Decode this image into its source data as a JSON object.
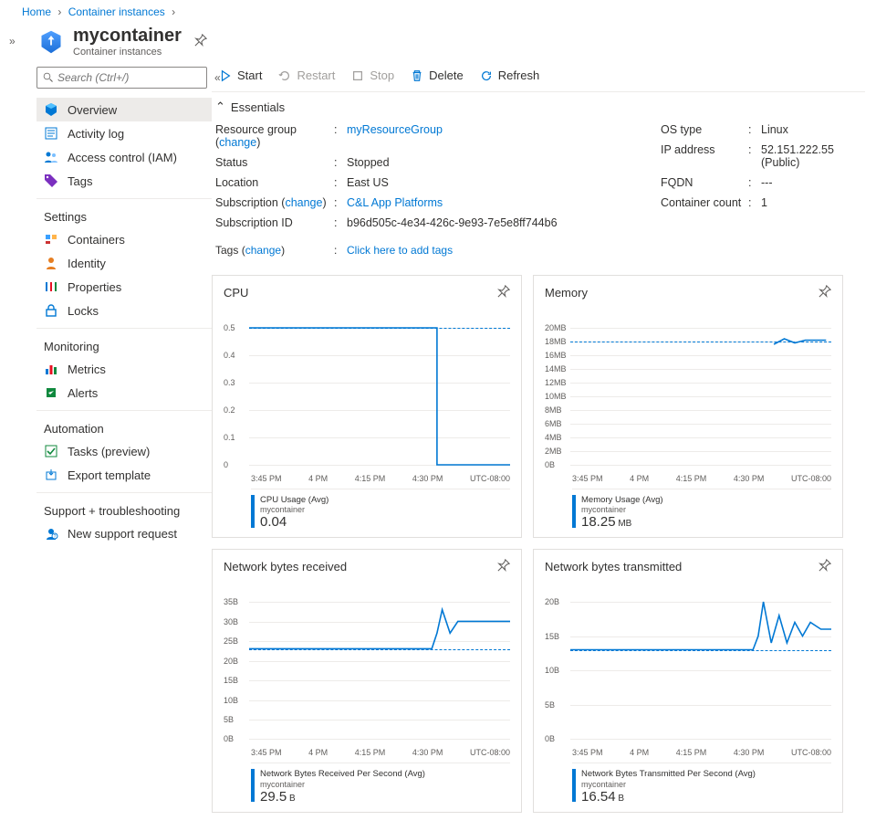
{
  "breadcrumb": {
    "home": "Home",
    "ci": "Container instances"
  },
  "title": "mycontainer",
  "subtitle": "Container instances",
  "search_placeholder": "Search (Ctrl+/)",
  "nav": {
    "overview": "Overview",
    "activity": "Activity log",
    "iam": "Access control (IAM)",
    "tags": "Tags",
    "heading_settings": "Settings",
    "containers": "Containers",
    "identity": "Identity",
    "properties": "Properties",
    "locks": "Locks",
    "heading_monitoring": "Monitoring",
    "metrics": "Metrics",
    "alerts": "Alerts",
    "heading_automation": "Automation",
    "tasks": "Tasks (preview)",
    "export": "Export template",
    "heading_support": "Support + troubleshooting",
    "support": "New support request"
  },
  "toolbar": {
    "start": "Start",
    "restart": "Restart",
    "stop": "Stop",
    "delete": "Delete",
    "refresh": "Refresh"
  },
  "essentials": {
    "header": "Essentials",
    "change": "change",
    "left": {
      "rg_label": "Resource group",
      "rg_value": "myResourceGroup",
      "status_label": "Status",
      "status_value": "Stopped",
      "loc_label": "Location",
      "loc_value": "East US",
      "sub_label": "Subscription",
      "sub_value": "C&L App Platforms",
      "subid_label": "Subscription ID",
      "subid_value": "b96d505c-4e34-426c-9e93-7e5e8ff744b6"
    },
    "right": {
      "os_label": "OS type",
      "os_value": "Linux",
      "ip_label": "IP address",
      "ip_value": "52.151.222.55 (Public)",
      "fqdn_label": "FQDN",
      "fqdn_value": "---",
      "count_label": "Container count",
      "count_value": "1"
    },
    "tags_label": "Tags",
    "tags_value": "Click here to add tags"
  },
  "chart_data": [
    {
      "title": "CPU",
      "type": "line",
      "y_ticks": [
        "0.5",
        "0.4",
        "0.3",
        "0.2",
        "0.1",
        "0"
      ],
      "x_ticks": [
        "3:45 PM",
        "4 PM",
        "4:15 PM",
        "4:30 PM",
        "UTC-08:00"
      ],
      "avg_dashed": 0.5,
      "series": [
        {
          "name": "CPU Usage (Avg)",
          "points": [
            [
              0,
              0.5
            ],
            [
              0.72,
              0.5
            ],
            [
              0.72,
              0
            ],
            [
              1,
              0
            ]
          ]
        }
      ],
      "metric_name": "CPU Usage (Avg)",
      "metric_sub": "mycontainer",
      "metric_value": "0.04",
      "metric_unit": ""
    },
    {
      "title": "Memory",
      "type": "line",
      "y_ticks": [
        "20MB",
        "18MB",
        "16MB",
        "14MB",
        "12MB",
        "10MB",
        "8MB",
        "6MB",
        "4MB",
        "2MB",
        "0B"
      ],
      "x_ticks": [
        "3:45 PM",
        "4 PM",
        "4:15 PM",
        "4:30 PM",
        "UTC-08:00"
      ],
      "avg_dashed": 18,
      "ymax": 20,
      "series": [
        {
          "name": "Memory Usage (Avg)",
          "points": [
            [
              0.78,
              17.6
            ],
            [
              0.82,
              18.4
            ],
            [
              0.86,
              17.8
            ],
            [
              0.9,
              18.2
            ],
            [
              0.94,
              18.2
            ],
            [
              0.98,
              18.2
            ]
          ]
        }
      ],
      "metric_name": "Memory Usage (Avg)",
      "metric_sub": "mycontainer",
      "metric_value": "18.25",
      "metric_unit": "MB"
    },
    {
      "title": "Network bytes received",
      "type": "line",
      "y_ticks": [
        "35B",
        "30B",
        "25B",
        "20B",
        "15B",
        "10B",
        "5B",
        "0B"
      ],
      "x_ticks": [
        "3:45 PM",
        "4 PM",
        "4:15 PM",
        "4:30 PM",
        "UTC-08:00"
      ],
      "avg_dashed": 23,
      "ymax": 35,
      "series": [
        {
          "name": "Network Bytes Received",
          "points": [
            [
              0,
              23
            ],
            [
              0.7,
              23
            ],
            [
              0.72,
              27
            ],
            [
              0.74,
              33
            ],
            [
              0.77,
              27
            ],
            [
              0.8,
              30
            ],
            [
              0.85,
              30
            ],
            [
              0.9,
              30
            ],
            [
              0.95,
              30
            ],
            [
              1,
              30
            ]
          ]
        }
      ],
      "metric_name": "Network Bytes Received Per Second (Avg)",
      "metric_sub": "mycontainer",
      "metric_value": "29.5",
      "metric_unit": "B"
    },
    {
      "title": "Network bytes transmitted",
      "type": "line",
      "y_ticks": [
        "20B",
        "15B",
        "10B",
        "5B",
        "0B"
      ],
      "x_ticks": [
        "3:45 PM",
        "4 PM",
        "4:15 PM",
        "4:30 PM",
        "UTC-08:00"
      ],
      "avg_dashed": 13,
      "ymax": 20,
      "series": [
        {
          "name": "Network Bytes Transmitted",
          "points": [
            [
              0,
              13
            ],
            [
              0.7,
              13
            ],
            [
              0.72,
              15
            ],
            [
              0.74,
              20
            ],
            [
              0.77,
              14
            ],
            [
              0.8,
              18
            ],
            [
              0.83,
              14
            ],
            [
              0.86,
              17
            ],
            [
              0.89,
              15
            ],
            [
              0.92,
              17
            ],
            [
              0.96,
              16
            ],
            [
              1,
              16
            ]
          ]
        }
      ],
      "metric_name": "Network Bytes Transmitted Per Second (Avg)",
      "metric_sub": "mycontainer",
      "metric_value": "16.54",
      "metric_unit": "B"
    }
  ]
}
